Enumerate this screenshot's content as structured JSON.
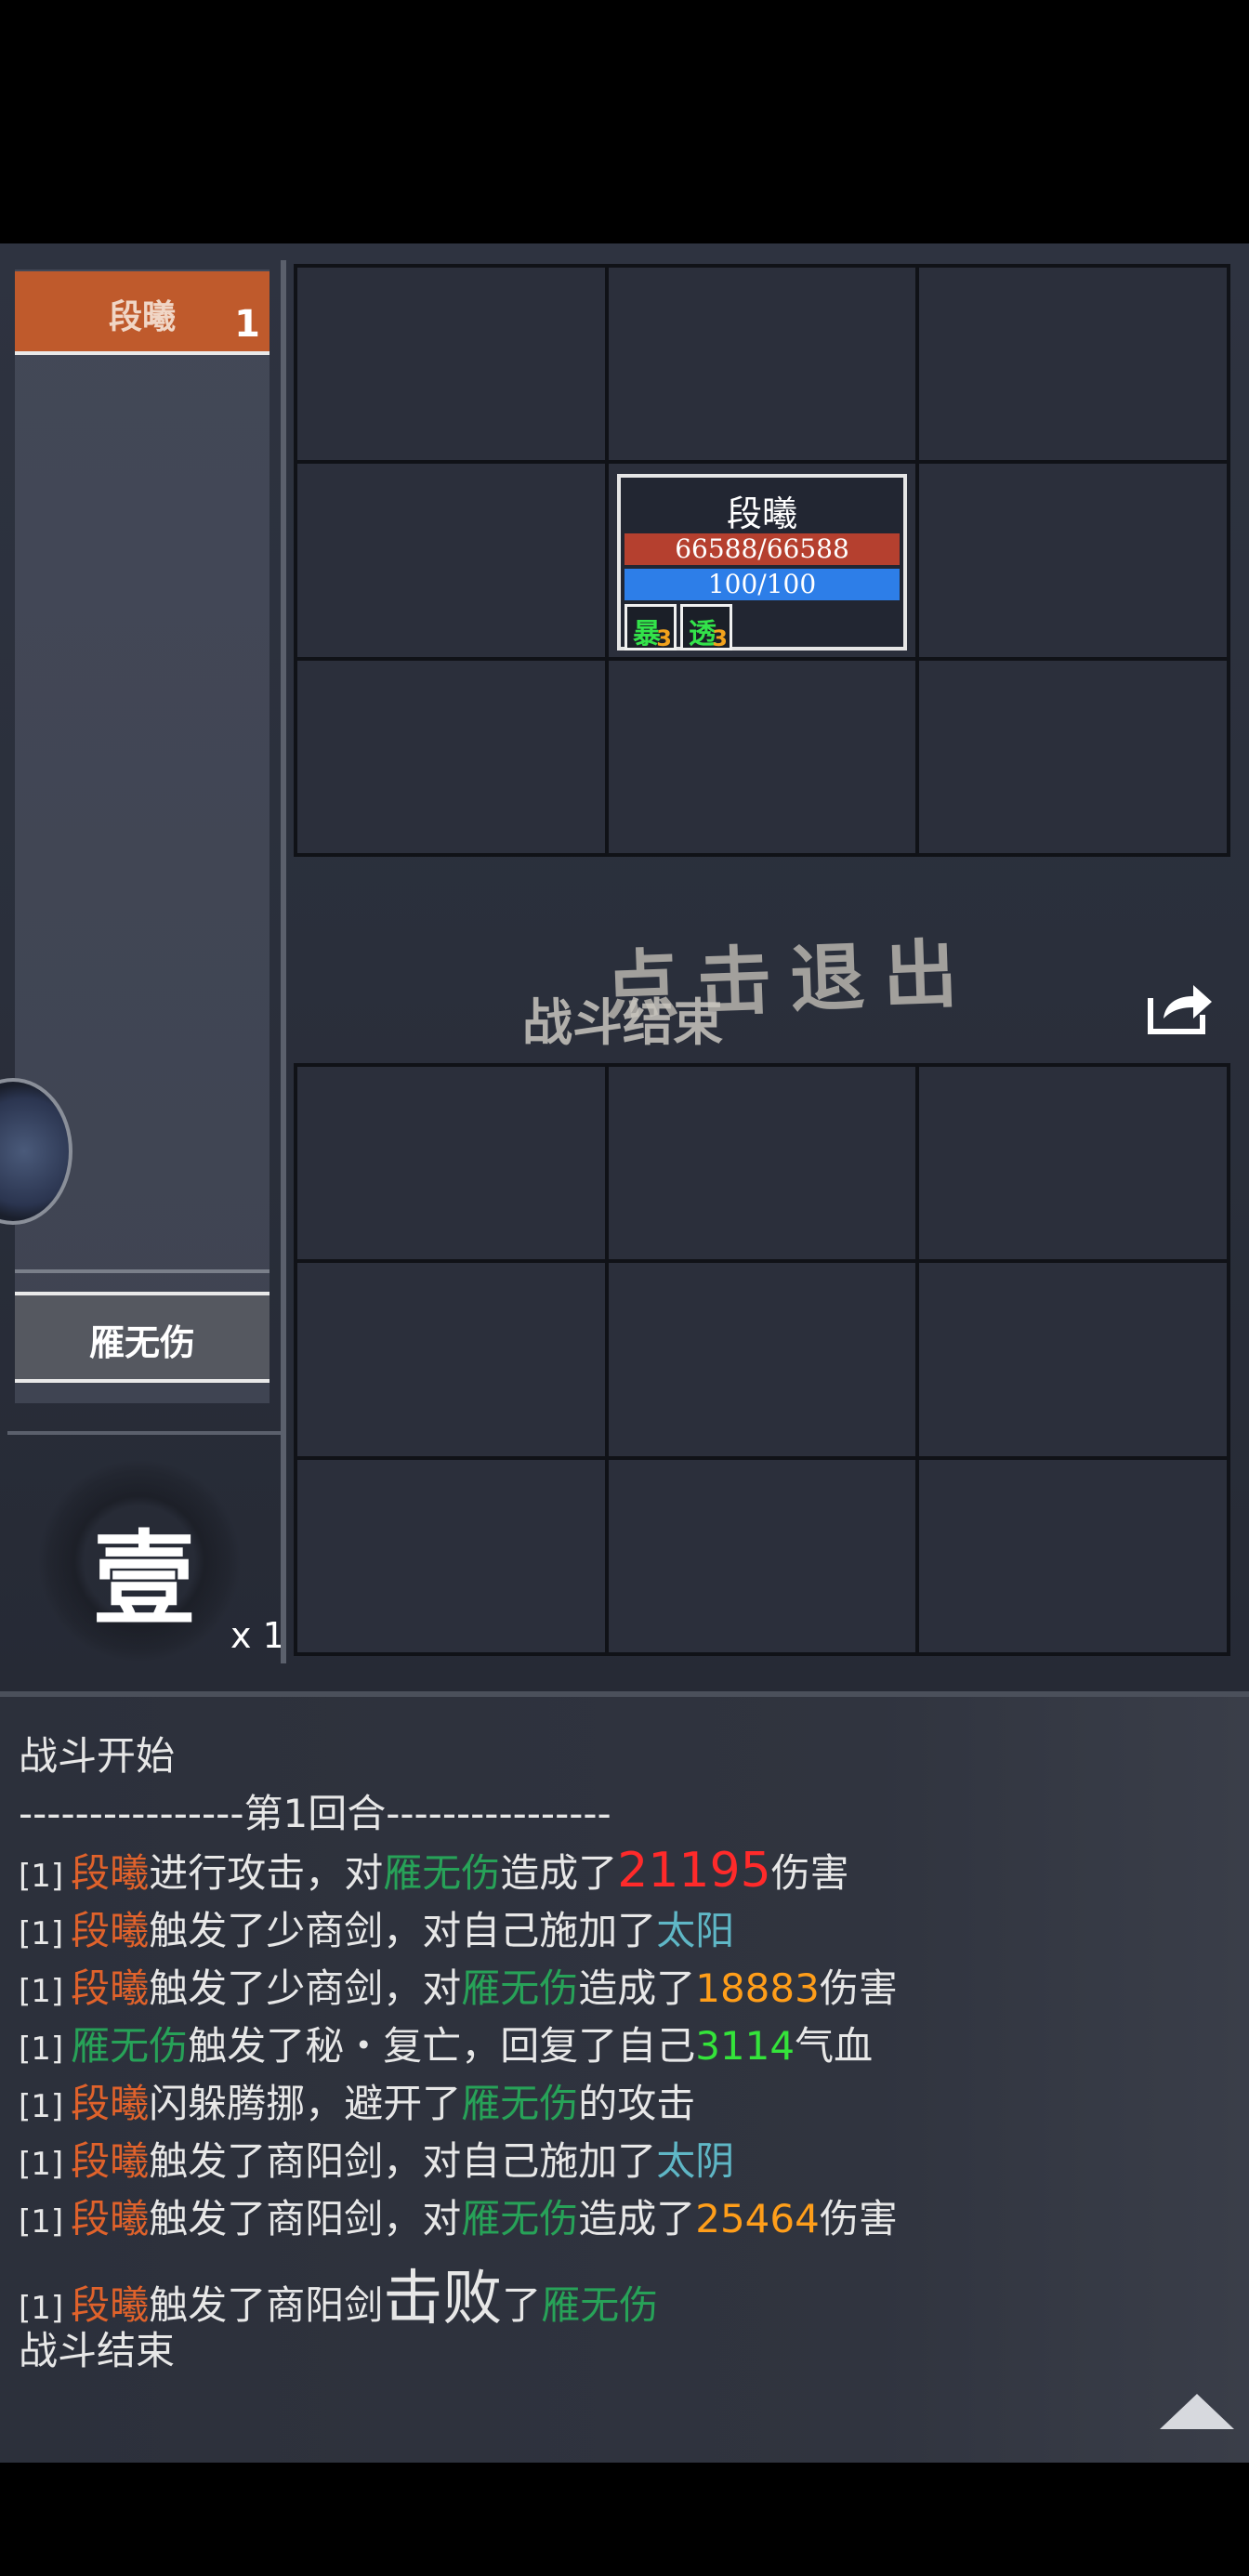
{
  "left_panel": {
    "player_name": "段曦",
    "player_count": "1",
    "enemy_name": "雁无伤",
    "round_label": "壹",
    "round_multiplier": "x 1"
  },
  "unit_card": {
    "name": "段曦",
    "hp_text": "66588/66588",
    "mp_text": "100/100",
    "hp_fraction": 1.0,
    "mp_fraction": 1.0,
    "buffs": [
      {
        "glyph": "暴",
        "level": "3"
      },
      {
        "glyph": "透",
        "level": "3"
      }
    ]
  },
  "overlay": {
    "click_exit": "点击退出",
    "battle_end": "战斗结束"
  },
  "log": {
    "start": "战斗开始",
    "round_header": "----------------第1回合----------------",
    "lines": [
      {
        "idx": "[1]",
        "parts": [
          [
            "me",
            "段曦"
          ],
          [
            "n",
            "进行攻击，对"
          ],
          [
            "foe",
            "雁无伤"
          ],
          [
            "n",
            "造成了"
          ],
          [
            "red",
            "21195"
          ],
          [
            "n",
            "伤害"
          ]
        ]
      },
      {
        "idx": "[1]",
        "parts": [
          [
            "me",
            "段曦"
          ],
          [
            "n",
            "触发了少商剑，对自己施加了"
          ],
          [
            "buff",
            "太阳"
          ]
        ]
      },
      {
        "idx": "[1]",
        "parts": [
          [
            "me",
            "段曦"
          ],
          [
            "n",
            "触发了少商剑，对"
          ],
          [
            "foe",
            "雁无伤"
          ],
          [
            "n",
            "造成了"
          ],
          [
            "orange",
            "18883"
          ],
          [
            "n",
            "伤害"
          ]
        ]
      },
      {
        "idx": "[1]",
        "parts": [
          [
            "foe",
            "雁无伤"
          ],
          [
            "n",
            "触发了秘・复亡，回复了自己"
          ],
          [
            "heal",
            "3114"
          ],
          [
            "n",
            "气血"
          ]
        ]
      },
      {
        "idx": "[1]",
        "parts": [
          [
            "me",
            "段曦"
          ],
          [
            "n",
            "闪躲腾挪，避开了"
          ],
          [
            "foe",
            "雁无伤"
          ],
          [
            "n",
            "的攻击"
          ]
        ]
      },
      {
        "idx": "[1]",
        "parts": [
          [
            "me",
            "段曦"
          ],
          [
            "n",
            "触发了商阳剑，对自己施加了"
          ],
          [
            "buff",
            "太阴"
          ]
        ]
      },
      {
        "idx": "[1]",
        "parts": [
          [
            "me",
            "段曦"
          ],
          [
            "n",
            "触发了商阳剑，对"
          ],
          [
            "foe",
            "雁无伤"
          ],
          [
            "n",
            "造成了"
          ],
          [
            "orange",
            "25464"
          ],
          [
            "n",
            "伤害"
          ]
        ]
      },
      {
        "idx": "[1]",
        "parts": [
          [
            "me",
            "段曦"
          ],
          [
            "n",
            "触发了商阳剑"
          ],
          [
            "big",
            "击败"
          ],
          [
            "n",
            "了"
          ],
          [
            "foe",
            "雁无伤"
          ]
        ]
      }
    ],
    "end": "战斗结束"
  },
  "colors": {
    "player": "#e0622b",
    "enemy": "#27a258",
    "crit_damage": "#ff2a2a",
    "damage": "#ff9e1a",
    "buff": "#5fb7c6",
    "heal": "#34e43a",
    "hp_bar": "#b5402f",
    "mp_bar": "#2d7ee8"
  }
}
